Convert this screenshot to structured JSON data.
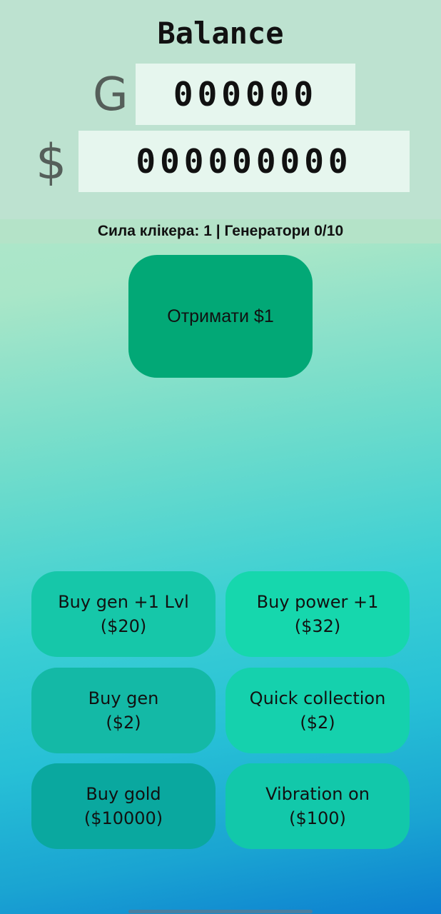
{
  "header": {
    "title": "Balance",
    "gold_symbol": "G",
    "gold_value": "000000",
    "dollar_symbol": "$",
    "dollar_value": "000000000"
  },
  "status": {
    "text": "Сила клікера: 1 | Генератори 0/10"
  },
  "earn_button": {
    "label": "Отримати $1"
  },
  "shop": [
    {
      "line1": "Buy gen +1 Lvl",
      "line2": "($20)"
    },
    {
      "line1": "Buy power +1",
      "line2": "($32)"
    },
    {
      "line1": "Buy gen",
      "line2": "($2)"
    },
    {
      "line1": "Quick collection",
      "line2": "($2)"
    },
    {
      "line1": "Buy gold",
      "line2": "($10000)"
    },
    {
      "line1": "Vibration on",
      "line2": "($100)"
    }
  ]
}
